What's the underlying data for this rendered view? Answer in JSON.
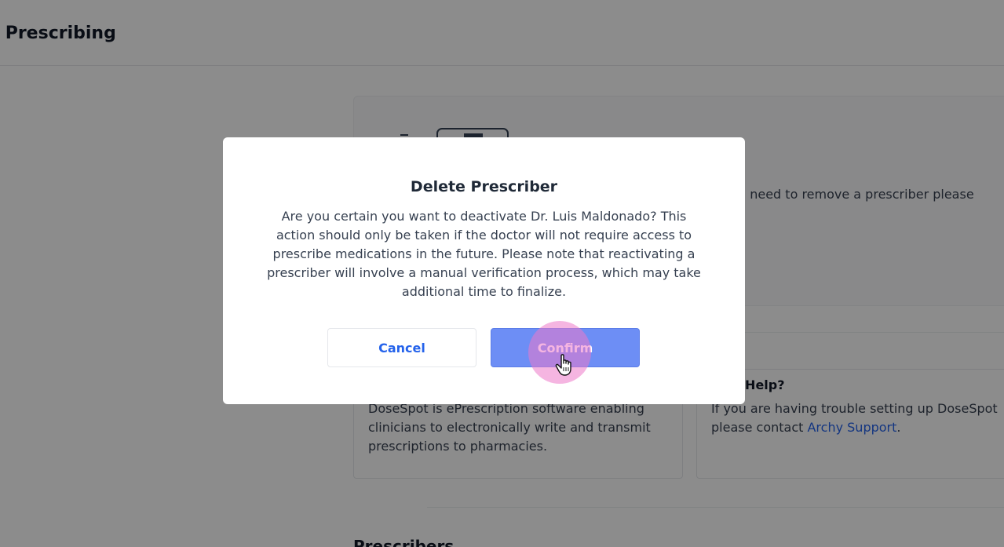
{
  "page": {
    "title": "c Prescribing",
    "card_text": "u need to remove a prescriber please",
    "left_panel": {
      "body": "DoseSpot is ePrescription software enabling clinicians to electronically write and transmit prescriptions to pharmacies."
    },
    "right_panel": {
      "title": "l Help?",
      "body_line1": "If you are having trouble setting up DoseSpot",
      "body_line2_prefix": "please contact ",
      "link": "Archy Support",
      "body_line2_suffix": "."
    },
    "section_title": "Prescribers"
  },
  "modal": {
    "title": "Delete Prescriber",
    "body": "Are you certain you want to deactivate Dr. Luis Maldonado? This action should only be taken if the doctor will not require access to prescribe medications in the future. Please note that reactivating a prescriber will involve a manual verification process, which may take additional time to finalize.",
    "cancel_label": "Cancel",
    "confirm_label": "Confirm"
  },
  "colors": {
    "accent": "#2563eb",
    "confirm_button": "#6d8ef5",
    "overlay": "rgba(0,0,0,0.45)",
    "click_indicator": "#ec78c8"
  },
  "icons": {
    "cursor": "hand-pointer-icon",
    "illustration": "prescription-device-illustration"
  }
}
